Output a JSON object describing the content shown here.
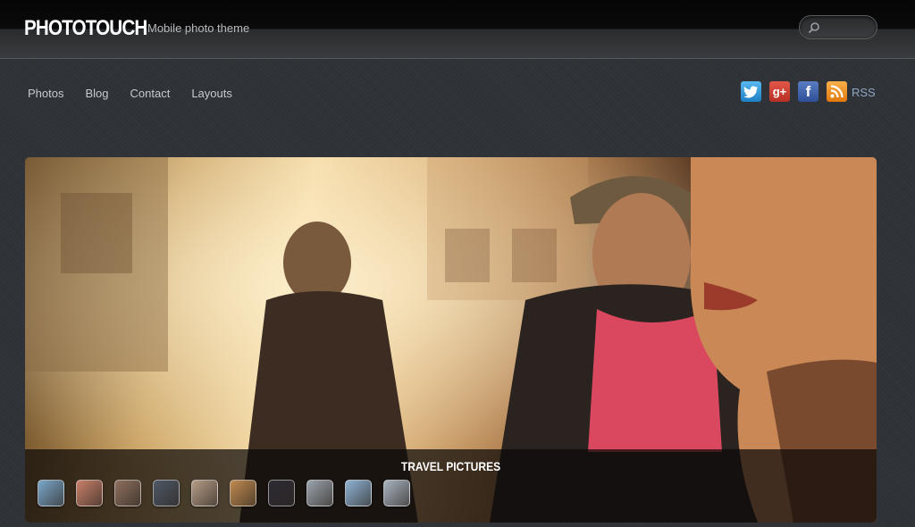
{
  "header": {
    "logo": "PHOTOTOUCH",
    "tagline": "Mobile photo theme",
    "search_value": ""
  },
  "nav": {
    "items": [
      {
        "label": "Photos"
      },
      {
        "label": "Blog"
      },
      {
        "label": "Contact"
      },
      {
        "label": "Layouts"
      }
    ]
  },
  "social": {
    "icons": [
      "twitter-icon",
      "google-plus-icon",
      "facebook-icon",
      "rss-icon"
    ],
    "google_plus_glyph": "g+",
    "facebook_glyph": "f",
    "rss_label": "RSS"
  },
  "slider": {
    "caption": "TRAVEL PICTURES",
    "thumbnails": [
      {
        "color": "#7aa6c9"
      },
      {
        "color": "#c9806a"
      },
      {
        "color": "#8d6f5e"
      },
      {
        "color": "#4e5866"
      },
      {
        "color": "#b59c86"
      },
      {
        "color": "#c08a4f"
      },
      {
        "color": "#2c2a34"
      },
      {
        "color": "#9aa3ac"
      },
      {
        "color": "#8fb3d4"
      },
      {
        "color": "#a7b3c0"
      }
    ]
  }
}
